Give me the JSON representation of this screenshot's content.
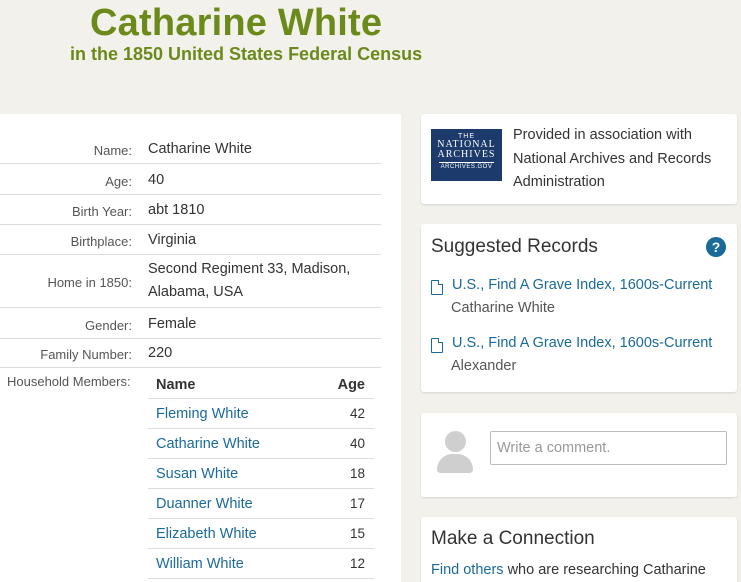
{
  "header": {
    "title": "Catharine White",
    "subtitle": "in the 1850 United States Federal Census"
  },
  "details": [
    {
      "label": "Name:",
      "value": "Catharine White"
    },
    {
      "label": "Age:",
      "value": "40"
    },
    {
      "label": "Birth Year:",
      "value": "abt 1810"
    },
    {
      "label": "Birthplace:",
      "value": "Virginia"
    },
    {
      "label": "Home in 1850:",
      "value": "Second Regiment 33, Madison, Alabama, USA"
    },
    {
      "label": "Gender:",
      "value": "Female"
    },
    {
      "label": "Family Number:",
      "value": "220"
    }
  ],
  "household": {
    "label": "Household Members:",
    "col_name": "Name",
    "col_age": "Age",
    "members": [
      {
        "name": "Fleming White",
        "age": "42"
      },
      {
        "name": "Catharine White",
        "age": "40"
      },
      {
        "name": "Susan White",
        "age": "18"
      },
      {
        "name": "Duanner White",
        "age": "17"
      },
      {
        "name": "Elizabeth White",
        "age": "15"
      },
      {
        "name": "William White",
        "age": "12"
      }
    ]
  },
  "archives": {
    "logo_line1": "THE",
    "logo_line2": "NATIONAL ARCHIVES",
    "logo_line3": "ARCHIVES.GOV",
    "text": "Provided in association with National Archives and Records Administration"
  },
  "suggested": {
    "title": "Suggested Records",
    "help_glyph": "?",
    "items": [
      {
        "link": "U.S., Find A Grave Index, 1600s-Current",
        "sub": "Catharine White"
      },
      {
        "link": "U.S., Find A Grave Index, 1600s-Current",
        "sub": "Alexander"
      }
    ]
  },
  "comment": {
    "placeholder": "Write a comment."
  },
  "connection": {
    "title": "Make a Connection",
    "link": "Find others",
    "text": " who are researching Catharine"
  },
  "colors": {
    "title_green": "#6c8a1a",
    "link_blue": "#1a6a9a",
    "archives_navy": "#1c3a6b"
  }
}
